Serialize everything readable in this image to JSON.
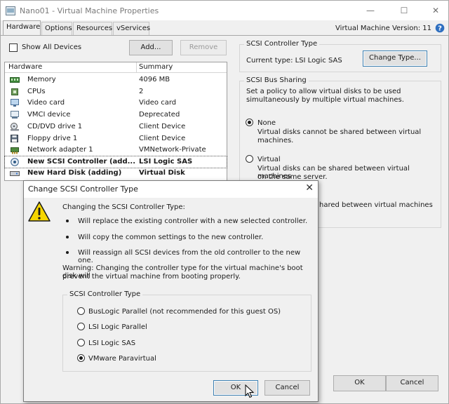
{
  "window": {
    "title": "Nano01 - Virtual Machine Properties",
    "controls": {
      "minimize": "—",
      "maximize": "☐",
      "close": "✕"
    },
    "tabs": [
      "Hardware",
      "Options",
      "Resources",
      "vServices"
    ],
    "active_tab": "Hardware",
    "vm_version": "Virtual Machine Version: 11"
  },
  "hardware": {
    "show_all_devices_label": "Show All Devices",
    "add_button": "Add...",
    "remove_button": "Remove",
    "columns": [
      "Hardware",
      "Summary"
    ],
    "rows": [
      {
        "name": "Memory",
        "summary": "4096 MB",
        "icon": "memory-icon"
      },
      {
        "name": "CPUs",
        "summary": "2",
        "icon": "cpu-icon"
      },
      {
        "name": "Video card",
        "summary": "Video card",
        "icon": "monitor-icon"
      },
      {
        "name": "VMCI device",
        "summary": "Deprecated",
        "icon": "vmci-icon"
      },
      {
        "name": "CD/DVD drive 1",
        "summary": "Client Device",
        "icon": "cd-drive-icon"
      },
      {
        "name": "Floppy drive 1",
        "summary": "Client Device",
        "icon": "floppy-icon"
      },
      {
        "name": "Network adapter 1",
        "summary": "VMNetwork-Private",
        "icon": "network-icon"
      },
      {
        "name": "New SCSI Controller (add...",
        "summary": "LSI Logic SAS",
        "icon": "scsi-icon"
      },
      {
        "name": "New Hard Disk (adding)",
        "summary": "Virtual Disk",
        "icon": "disk-icon"
      }
    ]
  },
  "scsi_controller": {
    "group_title": "SCSI Controller Type",
    "current_type": "Current type:  LSI Logic SAS",
    "change_button": "Change Type..."
  },
  "bus_sharing": {
    "group_title": "SCSI Bus Sharing",
    "description_1": "Set a policy to allow virtual disks to be used",
    "description_2": "simultaneously by multiple virtual machines.",
    "options": [
      {
        "label": "None",
        "desc_1": "Virtual disks cannot be shared between virtual",
        "desc_2": "machines."
      },
      {
        "label": "Virtual",
        "desc_1": "Virtual disks can be shared between virtual machines",
        "desc_2": "on the same server."
      }
    ],
    "partial_text": "hared between virtual machines"
  },
  "footer": {
    "ok": "OK",
    "cancel": "Cancel"
  },
  "dialog": {
    "title": "Change SCSI Controller Type",
    "close": "✕",
    "intro": "Changing the SCSI Controller Type:",
    "bullets": [
      "Will replace the existing controller with a new selected controller.",
      "Will copy the common settings to the new controller.",
      "Will reassign all SCSI devices from the old controller to the new one."
    ],
    "warning_1": "Warning: Changing the controller type for the virtual machine's boot disk will",
    "warning_2": "prevent the virtual machine from booting properly.",
    "group_title": "SCSI Controller Type",
    "options": [
      "BusLogic Parallel (not recommended for this guest OS)",
      "LSI Logic Parallel",
      "LSI Logic SAS",
      "VMware Paravirtual"
    ],
    "selected": "VMware Paravirtual",
    "ok": "OK",
    "cancel": "Cancel"
  }
}
